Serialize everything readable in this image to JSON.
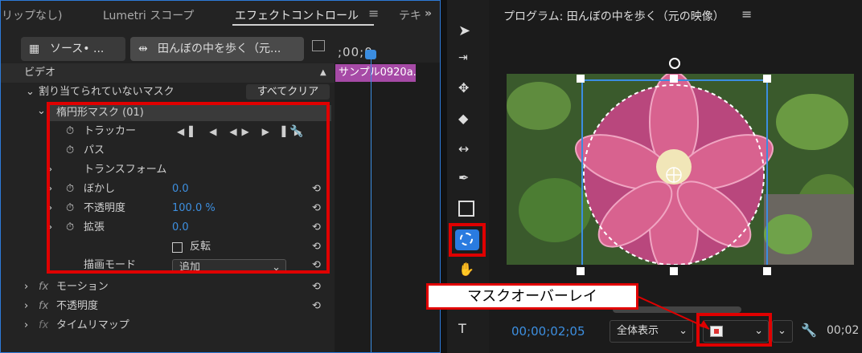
{
  "left_panel": {
    "tabs": [
      "リップなし)",
      "Lumetri スコープ",
      "エフェクトコントロール",
      "テキ"
    ],
    "source_label": "ソース• ...",
    "clip_selector": "田んぼの中を歩く（元...",
    "timecode_partial": ";00;0",
    "clip_name": "サンプル0920a.",
    "section_video": "ビデオ",
    "unassigned_mask": "割り当てられていないマスク",
    "clear_all": "すべてクリア",
    "ellipse_mask": "楕円形マスク (01)",
    "tracker_label": "トラッカー",
    "path_label": "パス",
    "transform_label": "トランスフォーム",
    "blur_label": "ぼかし",
    "blur_value": "0.0",
    "opacity_label": "不透明度",
    "opacity_value": "100.0 %",
    "expand_label": "拡張",
    "expand_value": "0.0",
    "invert_label": "反転",
    "draw_mode_label": "描画モード",
    "draw_mode_value": "追加",
    "motion_label": "モーション",
    "opacity2_label": "不透明度",
    "time_remap_label": "タイムリマップ"
  },
  "program": {
    "title": "プログラム: 田んぼの中を歩く（元の映像）",
    "timecode": "00;00;02;05",
    "zoom": "全体表示",
    "partial_timecode": "00;02"
  },
  "annotation": {
    "tooltip": "マスクオーバーレイ"
  },
  "colors": {
    "accent_blue": "#3d8fe0",
    "highlight_red": "#e00000",
    "clip_purple": "#a64aa6"
  }
}
